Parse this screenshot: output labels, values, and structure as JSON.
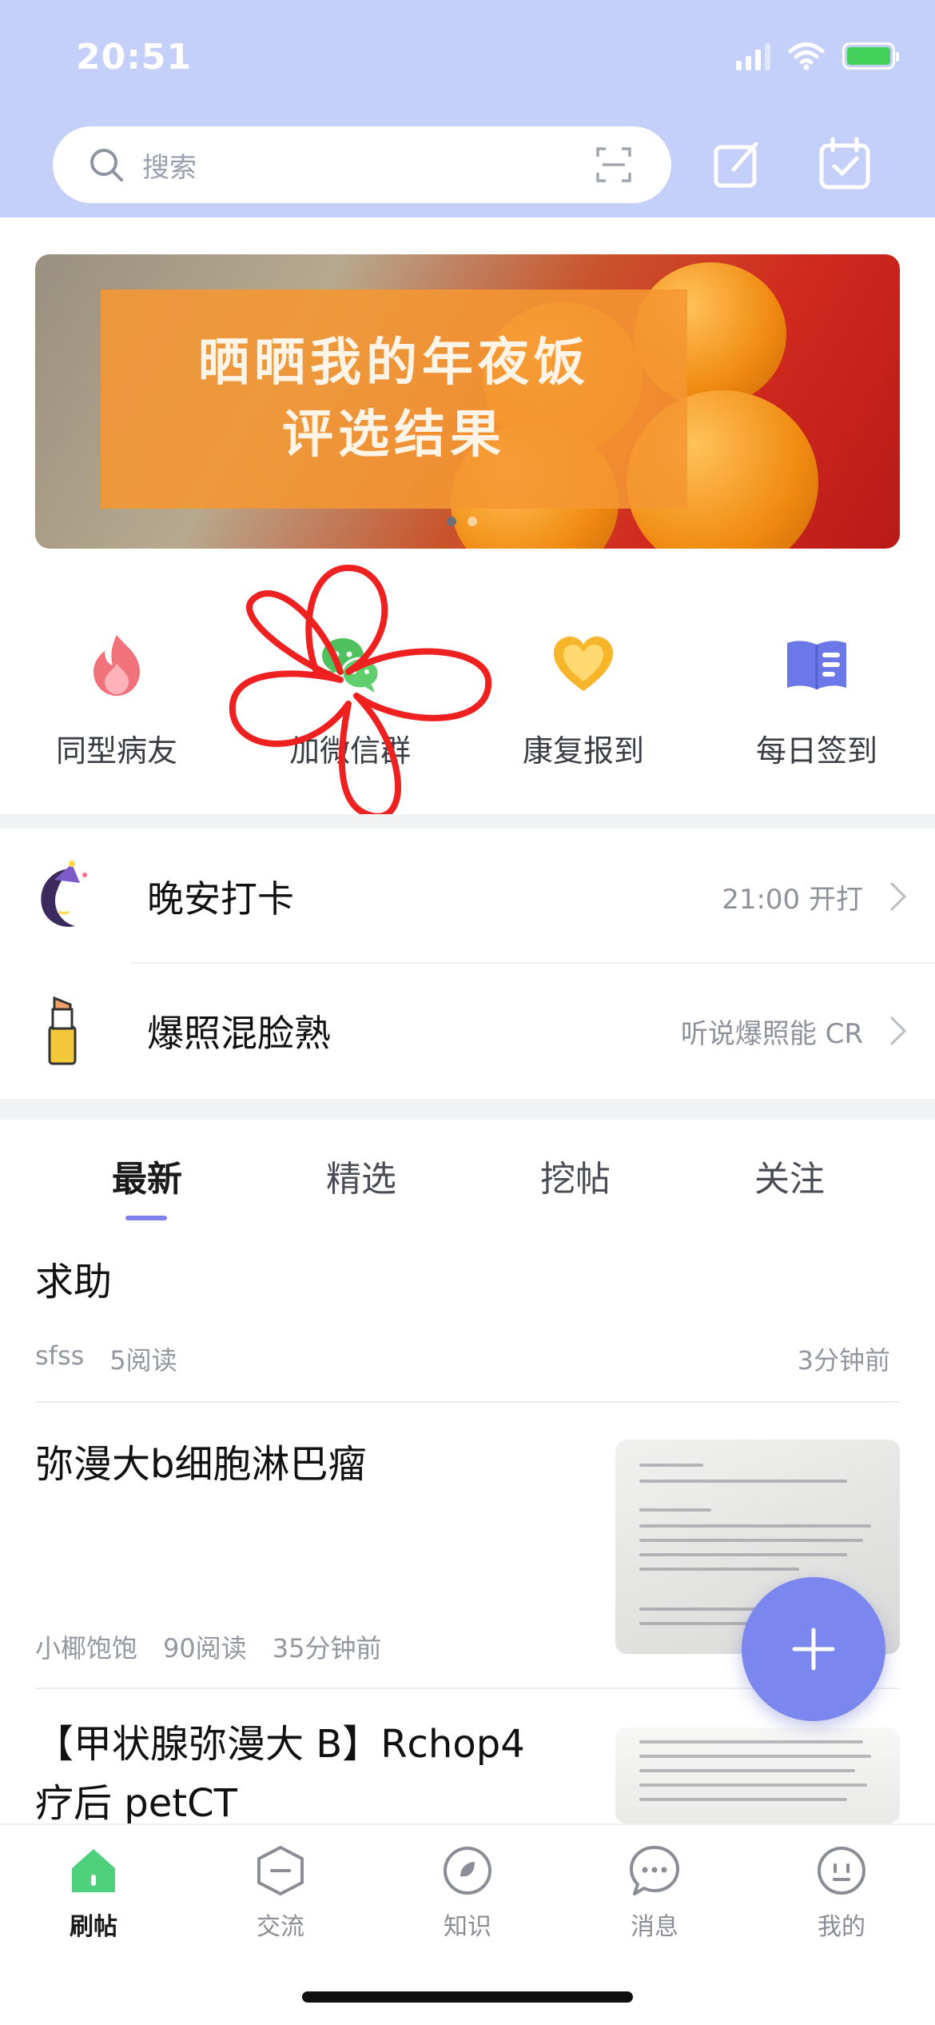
{
  "status_bar": {
    "time": "20:51"
  },
  "search": {
    "placeholder": "搜索"
  },
  "banner": {
    "line1": "晒晒我的年夜饭",
    "line2": "评选结果",
    "page_count": 2,
    "active_page": 0
  },
  "quick_entries": [
    {
      "label": "同型病友",
      "icon": "flame-icon"
    },
    {
      "label": "加微信群",
      "icon": "wechat-icon"
    },
    {
      "label": "康复报到",
      "icon": "heart-icon"
    },
    {
      "label": "每日签到",
      "icon": "book-icon"
    }
  ],
  "rows": [
    {
      "title": "晚安打卡",
      "hint": "21:00 开打",
      "icon": "moon-icon"
    },
    {
      "title": "爆照混脸熟",
      "hint": "听说爆照能 CR",
      "icon": "lipstick-icon"
    }
  ],
  "feed_tabs": [
    {
      "label": "最新",
      "active": true
    },
    {
      "label": "精选",
      "active": false
    },
    {
      "label": "挖帖",
      "active": false
    },
    {
      "label": "关注",
      "active": false
    }
  ],
  "posts": [
    {
      "title": "求助",
      "author": "sfss",
      "reads": "5阅读",
      "time": "3分钟前"
    },
    {
      "title": "弥漫大b细胞淋巴瘤",
      "author": "小椰饱饱",
      "reads": "90阅读",
      "time": "35分钟前"
    },
    {
      "title_line1": "【甲状腺弥漫大 B】Rchop4",
      "title_line2": "疗后 petCT"
    }
  ],
  "tabbar": [
    {
      "label": "刷帖",
      "active": true
    },
    {
      "label": "交流",
      "active": false
    },
    {
      "label": "知识",
      "active": false
    },
    {
      "label": "消息",
      "active": false
    },
    {
      "label": "我的",
      "active": false
    }
  ],
  "colors": {
    "header_bg": "#c4cffa",
    "accent": "#7b86ee",
    "home_green": "#4fd07c"
  }
}
